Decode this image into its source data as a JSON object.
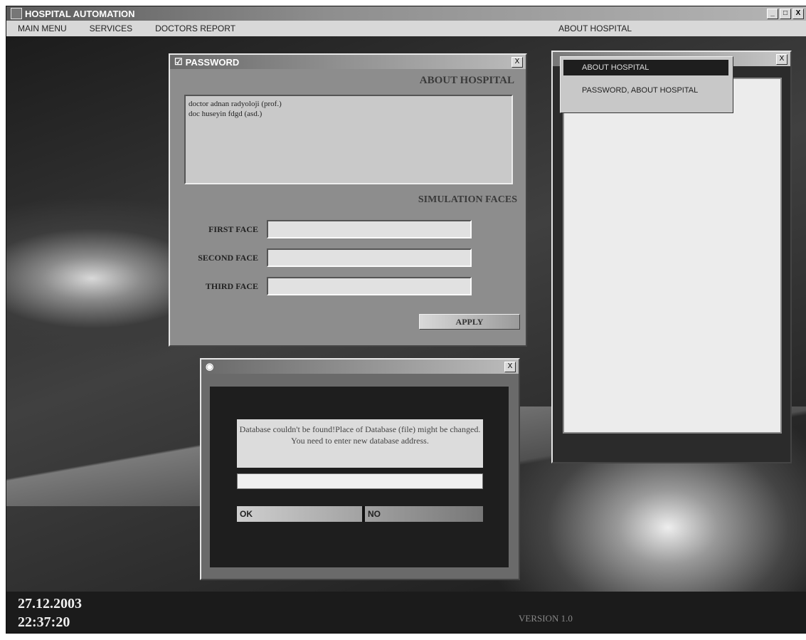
{
  "window": {
    "title": "HOSPITAL AUTOMATION",
    "minimize": "_",
    "maximize": "□",
    "close": "X"
  },
  "menu": {
    "items": [
      "MAIN MENU",
      "SERVICES",
      "DOCTORS REPORT"
    ],
    "about": "ABOUT HOSPITAL"
  },
  "dropdown": {
    "items": [
      "ABOUT HOSPITAL",
      "PASSWORD, ABOUT HOSPITAL"
    ],
    "selected_index": 0
  },
  "password_dialog": {
    "title": "PASSWORD",
    "close": "X",
    "heading": "ABOUT HOSPITAL",
    "memo_lines": [
      "doctor adnan radyoloji (prof.)",
      "doc huseyin fdgd (asd.)"
    ],
    "section_title": "SIMULATION FACES",
    "fields": [
      {
        "label": "FIRST FACE",
        "value": ""
      },
      {
        "label": "SECOND FACE",
        "value": ""
      },
      {
        "label": "THIRD FACE",
        "value": ""
      }
    ],
    "apply": "APPLY"
  },
  "message_dialog": {
    "close": "X",
    "text": "Database couldn't be found!Place of Database (file) might be changed. You need to enter new database address.",
    "input_value": "",
    "ok": "OK",
    "no": "NO"
  },
  "about_window": {
    "close": "X"
  },
  "status": {
    "date": "27.12.2003",
    "time": "22:37:20",
    "version": "VERSION 1.0"
  }
}
